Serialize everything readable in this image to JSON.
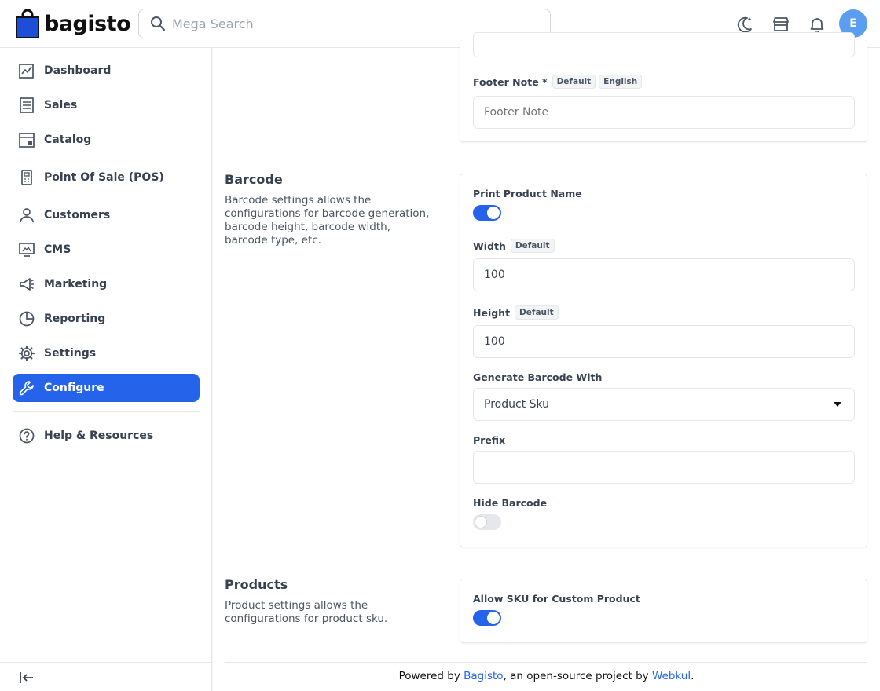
{
  "header": {
    "logo_text": "bagisto",
    "search_placeholder": "Mega Search",
    "avatar_initial": "E"
  },
  "sidebar": {
    "items": [
      {
        "label": "Dashboard"
      },
      {
        "label": "Sales"
      },
      {
        "label": "Catalog"
      },
      {
        "label": "Point Of Sale (POS)"
      },
      {
        "label": "Customers"
      },
      {
        "label": "CMS"
      },
      {
        "label": "Marketing"
      },
      {
        "label": "Reporting"
      },
      {
        "label": "Settings"
      },
      {
        "label": "Configure",
        "active": true
      },
      {
        "label": "Help & Resources"
      }
    ]
  },
  "invoice_card": {
    "footer_note_label": "Footer Note *",
    "badge_default": "Default",
    "badge_locale": "English",
    "footer_note_placeholder": "Footer Note"
  },
  "barcode": {
    "title": "Barcode",
    "description": "Barcode settings allows the configurations for barcode generation, barcode height, barcode width, barcode type, etc.",
    "print_product_name_label": "Print Product Name",
    "print_product_name_on": true,
    "width_label": "Width",
    "width_badge": "Default",
    "width_value": "100",
    "height_label": "Height",
    "height_badge": "Default",
    "height_value": "100",
    "generate_with_label": "Generate Barcode With",
    "generate_with_value": "Product Sku",
    "prefix_label": "Prefix",
    "prefix_value": "",
    "hide_barcode_label": "Hide Barcode",
    "hide_barcode_on": false
  },
  "products": {
    "title": "Products",
    "description": "Product settings allows the configurations for product sku.",
    "allow_sku_label": "Allow SKU for Custom Product",
    "allow_sku_on": true
  },
  "footer": {
    "prefix": "Powered by ",
    "bagisto_link": "Bagisto",
    "middle": ", an open-source project by ",
    "webkul_link": "Webkul",
    "suffix": "."
  },
  "colors": {
    "accent": "#2563eb",
    "avatar": "#5b9ef0"
  }
}
